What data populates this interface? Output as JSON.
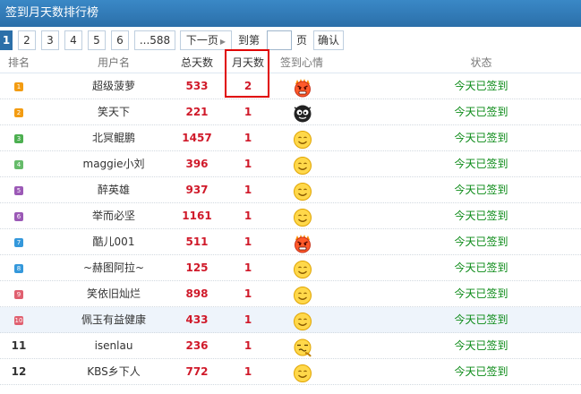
{
  "window": {
    "title": "签到月天数排行榜"
  },
  "pager": {
    "pages": [
      "1",
      "2",
      "3",
      "4",
      "5",
      "6",
      "...588"
    ],
    "current": "1",
    "next_label": "下一页",
    "goto_label": "到第",
    "goto_value": "",
    "page_suffix": "页",
    "confirm_label": "确认"
  },
  "table": {
    "headers": {
      "rank": "排名",
      "user": "用户名",
      "total_days": "总天数",
      "month_days": "月天数",
      "mood": "签到心情",
      "status": "状态"
    },
    "rows": [
      {
        "rank": "1",
        "user": "超级菠萝",
        "total": "533",
        "month": "2",
        "mood": "angry-face-icon",
        "status": "今天已签到"
      },
      {
        "rank": "2",
        "user": "笑天下",
        "total": "221",
        "month": "1",
        "mood": "black-face-icon",
        "status": "今天已签到"
      },
      {
        "rank": "3",
        "user": "北冥鲲鹏",
        "total": "1457",
        "month": "1",
        "mood": "smile-face-icon",
        "status": "今天已签到"
      },
      {
        "rank": "4",
        "user": "maggie小刘",
        "total": "396",
        "month": "1",
        "mood": "smile-face-icon",
        "status": "今天已签到"
      },
      {
        "rank": "5",
        "user": "醉英雄",
        "total": "937",
        "month": "1",
        "mood": "smile-face-icon",
        "status": "今天已签到"
      },
      {
        "rank": "6",
        "user": "举而必坚",
        "total": "1161",
        "month": "1",
        "mood": "smile-face-icon",
        "status": "今天已签到"
      },
      {
        "rank": "7",
        "user": "酷儿001",
        "total": "511",
        "month": "1",
        "mood": "angry-face-icon",
        "status": "今天已签到"
      },
      {
        "rank": "8",
        "user": "~赫图阿拉~",
        "total": "125",
        "month": "1",
        "mood": "smile-face-icon",
        "status": "今天已签到"
      },
      {
        "rank": "9",
        "user": "笑依旧灿烂",
        "total": "898",
        "month": "1",
        "mood": "smile-face-icon",
        "status": "今天已签到"
      },
      {
        "rank": "10",
        "user": "佩玉有益健康",
        "total": "433",
        "month": "1",
        "mood": "smile-face-icon",
        "status": "今天已签到"
      },
      {
        "rank": "11",
        "user": "isenlau",
        "total": "236",
        "month": "1",
        "mood": "dizzy-face-icon",
        "status": "今天已签到"
      },
      {
        "rank": "12",
        "user": "KBS乡下人",
        "total": "772",
        "month": "1",
        "mood": "smile-face-icon",
        "status": "今天已签到"
      }
    ]
  },
  "colors": {
    "title_bar": "#2b6fa9",
    "count_red": "#d01a2a",
    "status_green": "#0a8a16",
    "annotation_red": "#e00000",
    "badge_colors": [
      "#f39c12",
      "#f39c12",
      "#4caf50",
      "#66bb6a",
      "#9b59b6",
      "#9b59b6",
      "#3498db",
      "#3498db",
      "#e06070",
      "#e06070"
    ]
  }
}
